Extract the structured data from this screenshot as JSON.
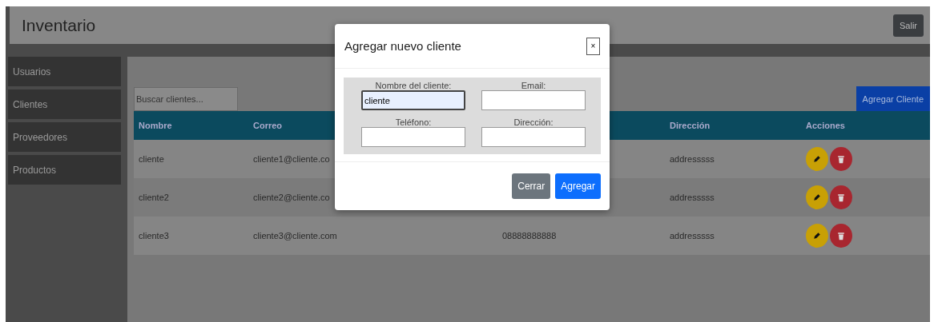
{
  "header": {
    "title": "Inventario",
    "logout_button": "Salir"
  },
  "sidebar": {
    "items": [
      {
        "label": "Usuarios"
      },
      {
        "label": "Clientes"
      },
      {
        "label": "Proveedores"
      },
      {
        "label": "Productos"
      }
    ]
  },
  "search": {
    "placeholder": "Buscar clientes..."
  },
  "add_button": "Agregar Cliente",
  "table": {
    "columns": [
      {
        "label": "Nombre"
      },
      {
        "label": "Correo"
      },
      {},
      {
        "label": "Dirección"
      },
      {
        "label": "Acciones"
      }
    ],
    "rows": [
      {
        "name": "cliente",
        "email": "cliente1@cliente.co",
        "address": "addresssss"
      },
      {
        "name": "cliente2",
        "email": "cliente2@cliente.co",
        "address": "addresssss"
      },
      {
        "name": "cliente3",
        "email": "cliente3@cliente.com",
        "phone": "08888888888",
        "address": "addresssss"
      }
    ]
  },
  "modal": {
    "title": "Agregar nuevo cliente",
    "close": "×",
    "fields": [
      {
        "label": "Nombre del cliente:",
        "value": "cliente",
        "focused": true
      },
      {
        "label": "Email:",
        "focused": false
      },
      {
        "label": "Teléfono:",
        "focused": false
      },
      {
        "label": "Dirección:",
        "focused": false
      }
    ],
    "buttons": [
      {
        "label": "Cerrar",
        "kind": "secondary"
      },
      {
        "label": "Agregar",
        "kind": "primary"
      }
    ]
  }
}
